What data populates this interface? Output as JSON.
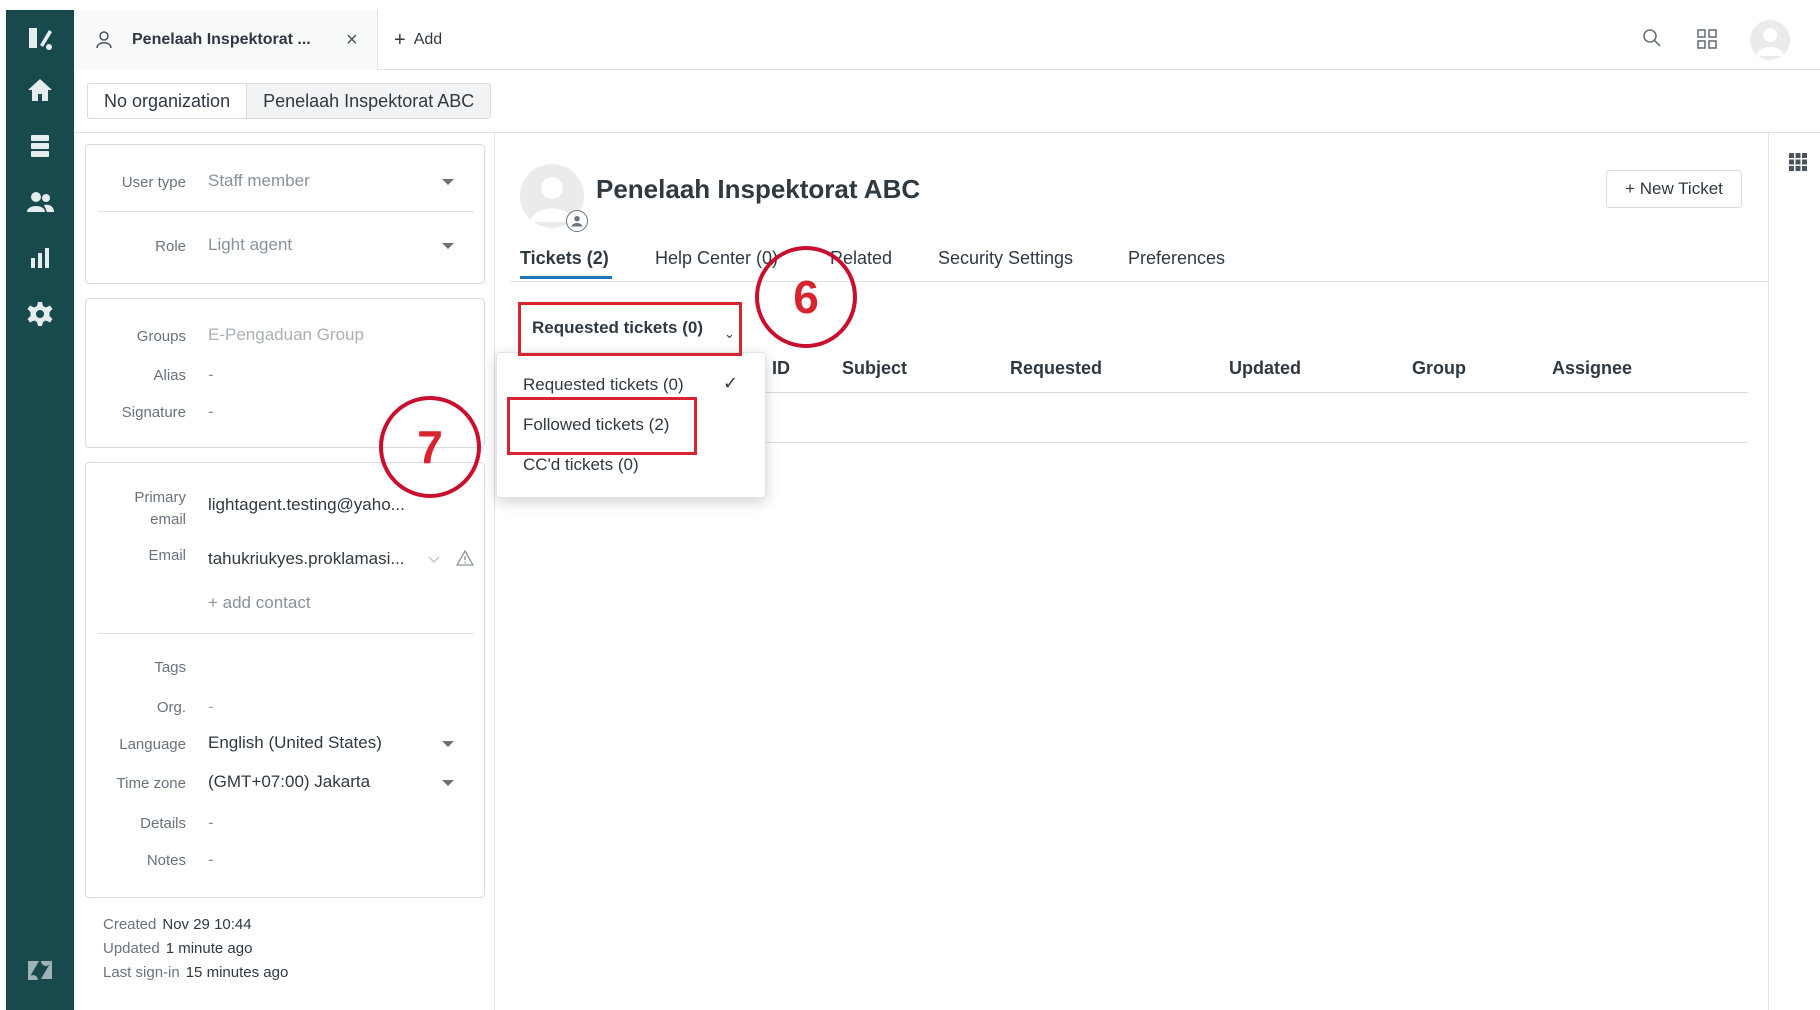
{
  "top_tab": {
    "label": "Penelaah Inspektorat ...",
    "close": "×"
  },
  "add_tab": {
    "plus": "+",
    "label": "Add"
  },
  "breadcrumbs": [
    "No organization",
    "Penelaah Inspektorat ABC"
  ],
  "user_card": {
    "user_type_label": "User type",
    "user_type_value": "Staff member",
    "role_label": "Role",
    "role_value": "Light agent"
  },
  "groups_card": {
    "groups_label": "Groups",
    "groups_value": "E-Pengaduan Group",
    "alias_label": "Alias",
    "alias_value": "-",
    "signature_label": "Signature",
    "signature_value": "-"
  },
  "contact_card": {
    "primary_email_label_1": "Primary",
    "primary_email_label_2": "email",
    "primary_email_value": "lightagent.testing@yaho...",
    "email_label": "Email",
    "email_value": "tahukriukyes.proklamasi...",
    "add_contact": "+ add contact",
    "tags_label": "Tags",
    "org_label": "Org.",
    "org_value": "-",
    "language_label": "Language",
    "language_value": "English (United States)",
    "timezone_label": "Time zone",
    "timezone_value": "(GMT+07:00) Jakarta",
    "details_label": "Details",
    "details_value": "-",
    "notes_label": "Notes",
    "notes_value": "-"
  },
  "meta": {
    "created_label": "Created",
    "created_value": "Nov 29 10:44",
    "updated_label": "Updated",
    "updated_value": "1 minute ago",
    "last_signin_label": "Last sign-in",
    "last_signin_value": "15 minutes ago"
  },
  "profile": {
    "name": "Penelaah Inspektorat ABC",
    "new_ticket": "+ New Ticket"
  },
  "tabs": [
    "Tickets (2)",
    "Help Center (0)",
    "Related",
    "Security Settings",
    "Preferences"
  ],
  "ticket_scope": {
    "label": "Requested tickets (0)",
    "chevron": "⌄"
  },
  "table_headers": [
    "ID",
    "Subject",
    "Requested",
    "Updated",
    "Group",
    "Assignee"
  ],
  "dropdown": {
    "items": [
      "Requested tickets (0)",
      "Followed tickets (2)",
      "CC'd tickets (0)"
    ],
    "check": "✓"
  },
  "annotations": {
    "step6": "6",
    "step7": "7"
  },
  "colors": {
    "nav_bg": "#17494d",
    "accent": "#1f73b7",
    "annotation_red": "#d8242e"
  }
}
